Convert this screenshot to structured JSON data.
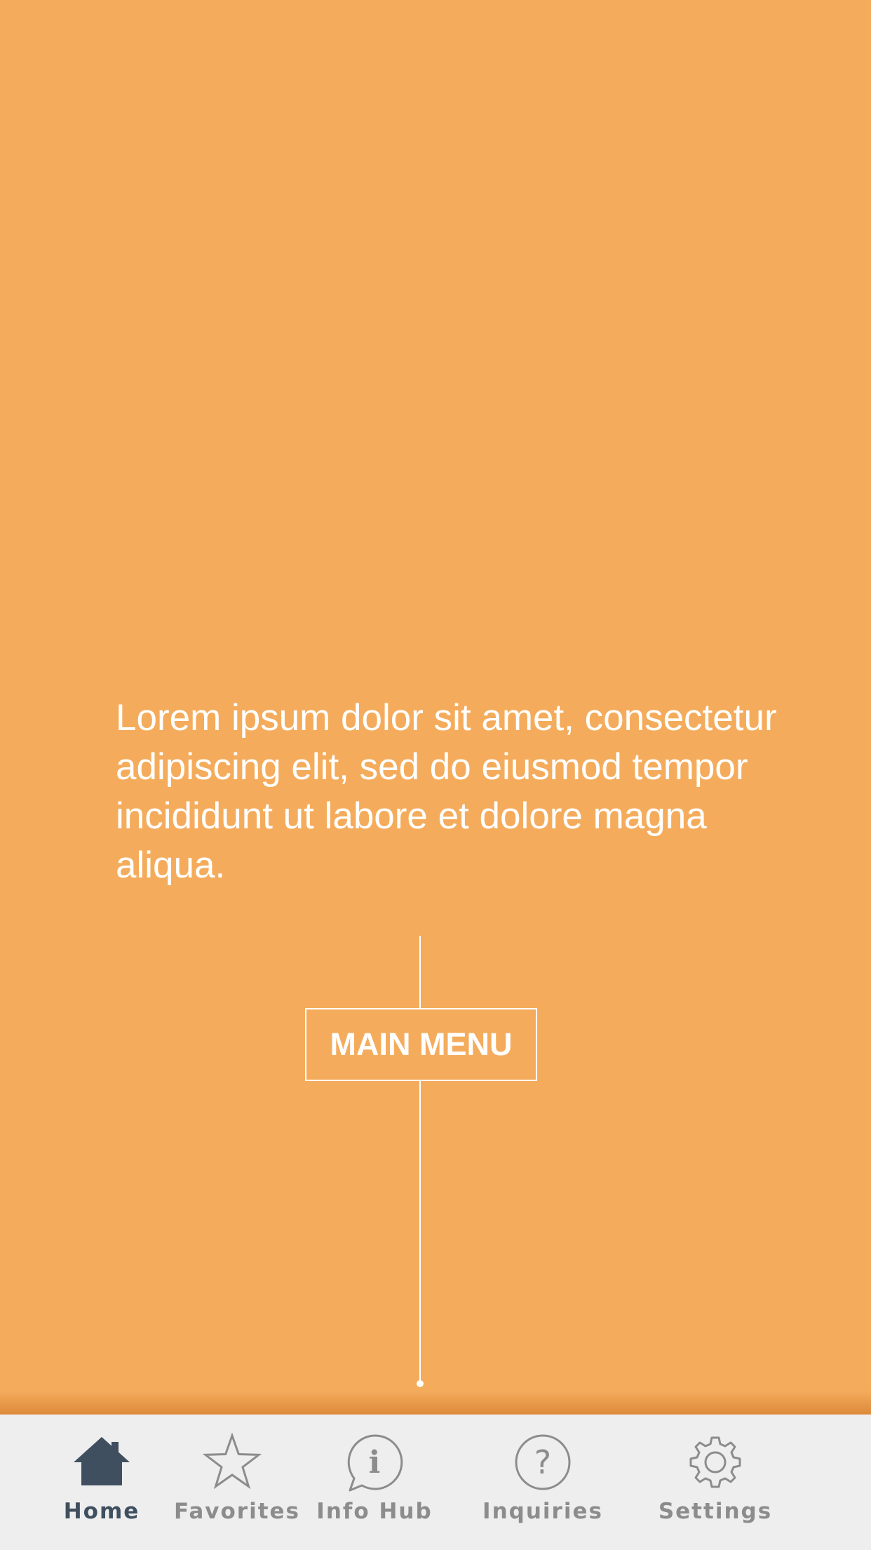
{
  "main": {
    "body_text": "Lorem ipsum dolor sit amet, consectetur adipiscing elit, sed do eiusmod tempor incididunt ut labore et dolore magna aliqua.",
    "menu_button_label": "MAIN MENU"
  },
  "tabbar": {
    "active_tab": "Home",
    "items": [
      {
        "label": "Home",
        "icon": "home-icon"
      },
      {
        "label": "Favorites",
        "icon": "star-icon"
      },
      {
        "label": "Info Hub",
        "icon": "info-bubble-icon"
      },
      {
        "label": "Inquiries",
        "icon": "question-icon"
      },
      {
        "label": "Settings",
        "icon": "gear-icon"
      }
    ]
  },
  "colors": {
    "background": "#f4ac5c",
    "text": "#ffffff",
    "tabbar_background": "#eeeeee",
    "tab_active": "#3f4f5f",
    "tab_inactive": "#8c8c8c"
  }
}
